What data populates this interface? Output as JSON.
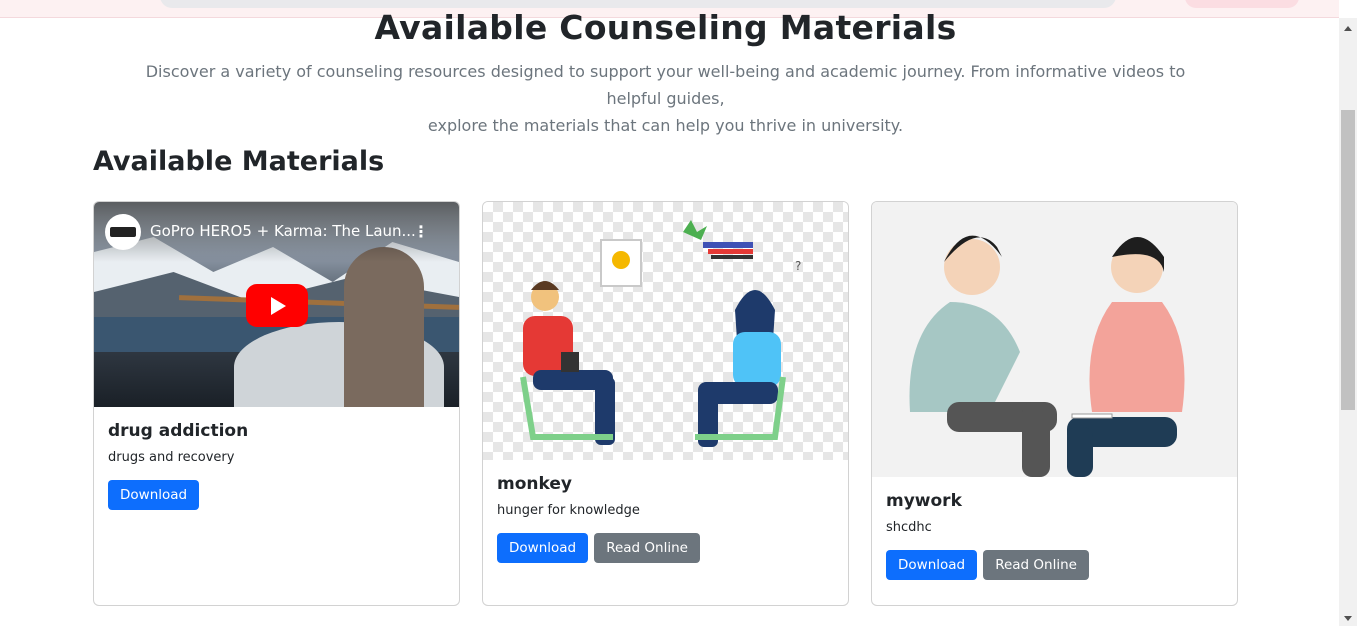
{
  "hero": {
    "title": "Available Counseling Materials",
    "subtitle_line1": "Discover a variety of counseling resources designed to support your well-being and academic journey. From informative videos to helpful guides,",
    "subtitle_line2": "explore the materials that can help you thrive in university."
  },
  "section": {
    "title": "Available Materials"
  },
  "cards": [
    {
      "media": "youtube-video",
      "video_title": "GoPro HERO5 + Karma: The Laun...",
      "title": "drug addiction",
      "description": "drugs and recovery",
      "download_label": "Download"
    },
    {
      "media": "counseling-illustration",
      "title": "monkey",
      "description": "hunger for knowledge",
      "download_label": "Download",
      "read_label": "Read Online"
    },
    {
      "media": "counseling-illustration",
      "title": "mywork",
      "description": "shcdhc",
      "download_label": "Download",
      "read_label": "Read Online"
    }
  ],
  "colors": {
    "primary": "#0d6efd",
    "secondary": "#6c757d",
    "youtube_red": "#ff0000"
  }
}
